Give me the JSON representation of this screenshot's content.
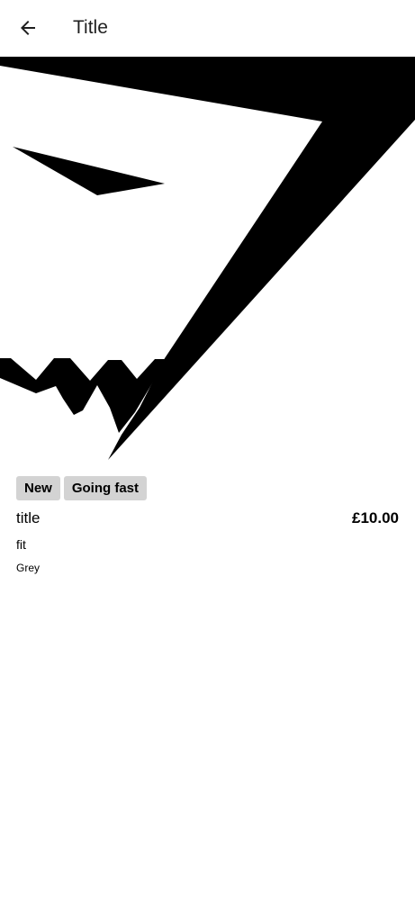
{
  "header": {
    "title": "Title",
    "back_icon": "arrow-back-icon"
  },
  "hero": {
    "image": "brand-logo-graphic"
  },
  "badges": [
    {
      "label": "New"
    },
    {
      "label": "Going fast"
    }
  ],
  "product": {
    "title": "title",
    "price": "£10.00",
    "fit": "fit",
    "colour": "Grey"
  },
  "colors": {
    "background": "#ffffff",
    "badge_background": "#d3d3d3",
    "text": "#000000"
  }
}
